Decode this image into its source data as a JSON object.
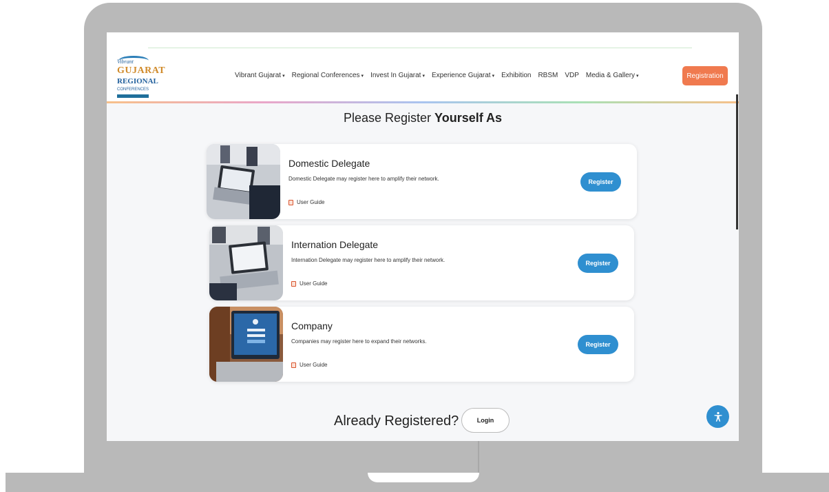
{
  "header": {
    "logo": {
      "line1": "Vibrant",
      "line2": "GUJARAT",
      "line3": "REGIONAL",
      "line4": "CONFERENCES"
    },
    "nav": [
      {
        "label": "Vibrant Gujarat",
        "dropdown": true
      },
      {
        "label": "Regional Conferences",
        "dropdown": true
      },
      {
        "label": "Invest In Gujarat",
        "dropdown": true
      },
      {
        "label": "Experience Gujarat",
        "dropdown": true
      },
      {
        "label": "Exhibition",
        "dropdown": false
      },
      {
        "label": "RBSM",
        "dropdown": false
      },
      {
        "label": "VDP",
        "dropdown": false
      },
      {
        "label": "Media & Gallery",
        "dropdown": true
      }
    ],
    "registration_label": "Registration",
    "dropdown_caret": "▾"
  },
  "main": {
    "title_prefix": "Please Register",
    "title_bold": "Yourself As",
    "cards": [
      {
        "title": "Domestic Delegate",
        "desc": "Domestic Delegate may register here to amplify their network.",
        "guide": "User Guide",
        "button": "Register"
      },
      {
        "title": "Internation Delegate",
        "desc": "Internation Delegate may register here to amplify their network.",
        "guide": "User Guide",
        "button": "Register"
      },
      {
        "title": "Company",
        "desc": "Companies may register here to expand their networks.",
        "guide": "User Guide",
        "button": "Register"
      }
    ],
    "already_registered": "Already Registered?",
    "login_label": "Login"
  },
  "colors": {
    "accent_orange": "#f07a4f",
    "primary_blue": "#2f8fd0"
  }
}
